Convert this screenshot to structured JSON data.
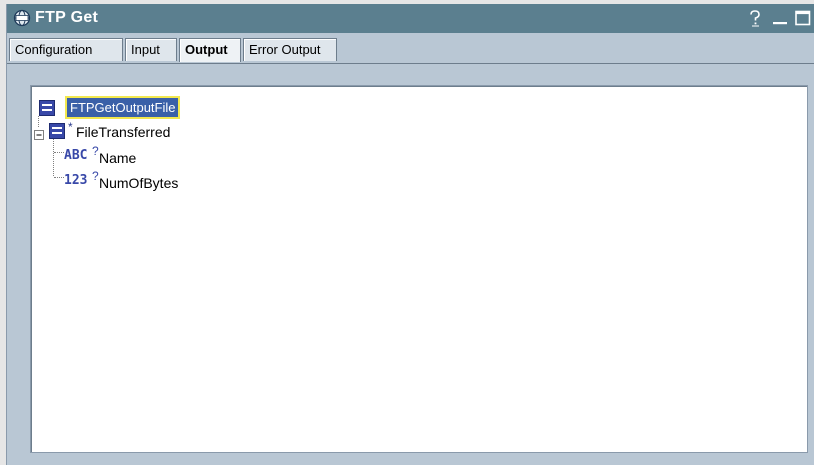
{
  "window": {
    "title": "FTP Get",
    "app_icon": "ftp-app-icon",
    "help_icon": "help-icon",
    "minimize_icon": "minimize-icon",
    "maximize_icon": "maximize-icon"
  },
  "tabs": [
    {
      "label": "Configuration",
      "active": false
    },
    {
      "label": "Input",
      "active": false
    },
    {
      "label": "Output",
      "active": true
    },
    {
      "label": "Error Output",
      "active": false
    }
  ],
  "tree": {
    "root": {
      "label": "FTPGetOutputFile",
      "icon": "record-icon",
      "selected": true
    },
    "child": {
      "label": "FileTransferred",
      "icon": "record-icon",
      "marker": "*",
      "expanded": true
    },
    "leaves": [
      {
        "label": "Name",
        "type_glyph": "ABC",
        "marker": "?",
        "icon": "string-type-icon"
      },
      {
        "label": "NumOfBytes",
        "type_glyph": "123",
        "marker": "?",
        "icon": "number-type-icon"
      }
    ]
  },
  "colors": {
    "titlebar": "#5b7f8f",
    "panel": "#b9c7d4",
    "selection": "#3a60a8",
    "selection_outline": "#f2e84e",
    "type_icon": "#3848a8"
  }
}
